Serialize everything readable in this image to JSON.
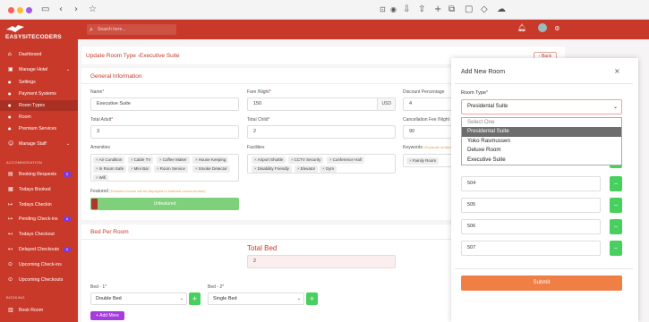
{
  "header": {
    "brand": "EASYSITECODERS",
    "search_placeholder": "Search here..."
  },
  "sidebar": {
    "items": [
      {
        "label": "Dashboard",
        "icon": "home-icon"
      },
      {
        "label": "Manage Hotel",
        "icon": "hotel-icon"
      },
      {
        "label": "Settings",
        "icon": "dot-icon"
      },
      {
        "label": "Payment Systems",
        "icon": "dot-icon"
      },
      {
        "label": "Room Types",
        "icon": "dot-icon"
      },
      {
        "label": "Room",
        "icon": "dot-icon"
      },
      {
        "label": "Premium Services",
        "icon": "dot-icon"
      },
      {
        "label": "Manage Staff",
        "icon": "users-icon"
      }
    ],
    "section_accommodation": "ACCOMMODATION",
    "accommodation_items": [
      {
        "label": "Booking Requests",
        "badge": "0"
      },
      {
        "label": "Todays Booked"
      },
      {
        "label": "Todays Checkin"
      },
      {
        "label": "Pending Check-ins",
        "badge": "0"
      },
      {
        "label": "Todays Checkout"
      },
      {
        "label": "Delayed Checkouts",
        "badge": "0"
      },
      {
        "label": "Upcoming Check-ins"
      },
      {
        "label": "Upcoming Checkouts"
      }
    ],
    "section_booking": "BOOKING",
    "booking_items": [
      {
        "label": "Book Room"
      }
    ]
  },
  "page": {
    "title": "Update Room Type -Executive Suite",
    "back_label": "Back",
    "general_heading": "General Information",
    "name_label": "Name",
    "name_value": "Executive Suite",
    "fare_label": "Fare /Night",
    "fare_value": "150",
    "fare_suffix": "USD",
    "discount_label": "Discount Percentage",
    "discount_value": "4",
    "adult_label": "Total Adult",
    "adult_value": "3",
    "child_label": "Total Child",
    "child_value": "2",
    "cancel_label": "Cancellation Fee /Night",
    "cancel_value": "90",
    "amenities_label": "Amenities",
    "amenities": [
      "Air Condition",
      "Cable TV",
      "Coffee Maker",
      "House Keeping",
      "In Room Safe",
      "Mini Bar",
      "Room Service",
      "Smoke Detector",
      "Wifi"
    ],
    "facilities_label": "Facilities",
    "facilities": [
      "Airport Shuttle",
      "CCTV Security",
      "Conference Hall",
      "Disability Friendly",
      "Elevator",
      "Gym"
    ],
    "keywords_label": "Keywords",
    "keywords_note": "(Separate multiple",
    "keywords": [
      "Family Room"
    ],
    "featured_label": "Featured",
    "featured_note": "(Featured rooms will be displayed in featured rooms section)",
    "featured_value": "Unfeatured",
    "bed_heading": "Bed Per Room",
    "total_bed_label": "Total Bed",
    "total_bed_value": "2",
    "bed1_label": "Bed - 1",
    "bed1_value": "Double Bed",
    "bed2_label": "Bed - 2",
    "bed2_value": "Single Bed",
    "add_more_label": "+ Add More"
  },
  "modal": {
    "title": "Add New Room",
    "close_icon": "close-icon",
    "room_type_label": "Room Type",
    "room_type_value": "Presidental Suite",
    "options": [
      "Select One",
      "Presidental Suite",
      "Yoko Rasmussen",
      "Deluxe Room",
      "Executive Suite"
    ],
    "highlighted_option": "Presidental Suite",
    "rooms": [
      "504",
      "505",
      "506",
      "507"
    ],
    "submit_label": "Submit"
  },
  "colors": {
    "brand": "#c8392a",
    "green": "#48d05e",
    "submit": "#f07f45",
    "purple": "#a43ce0"
  }
}
